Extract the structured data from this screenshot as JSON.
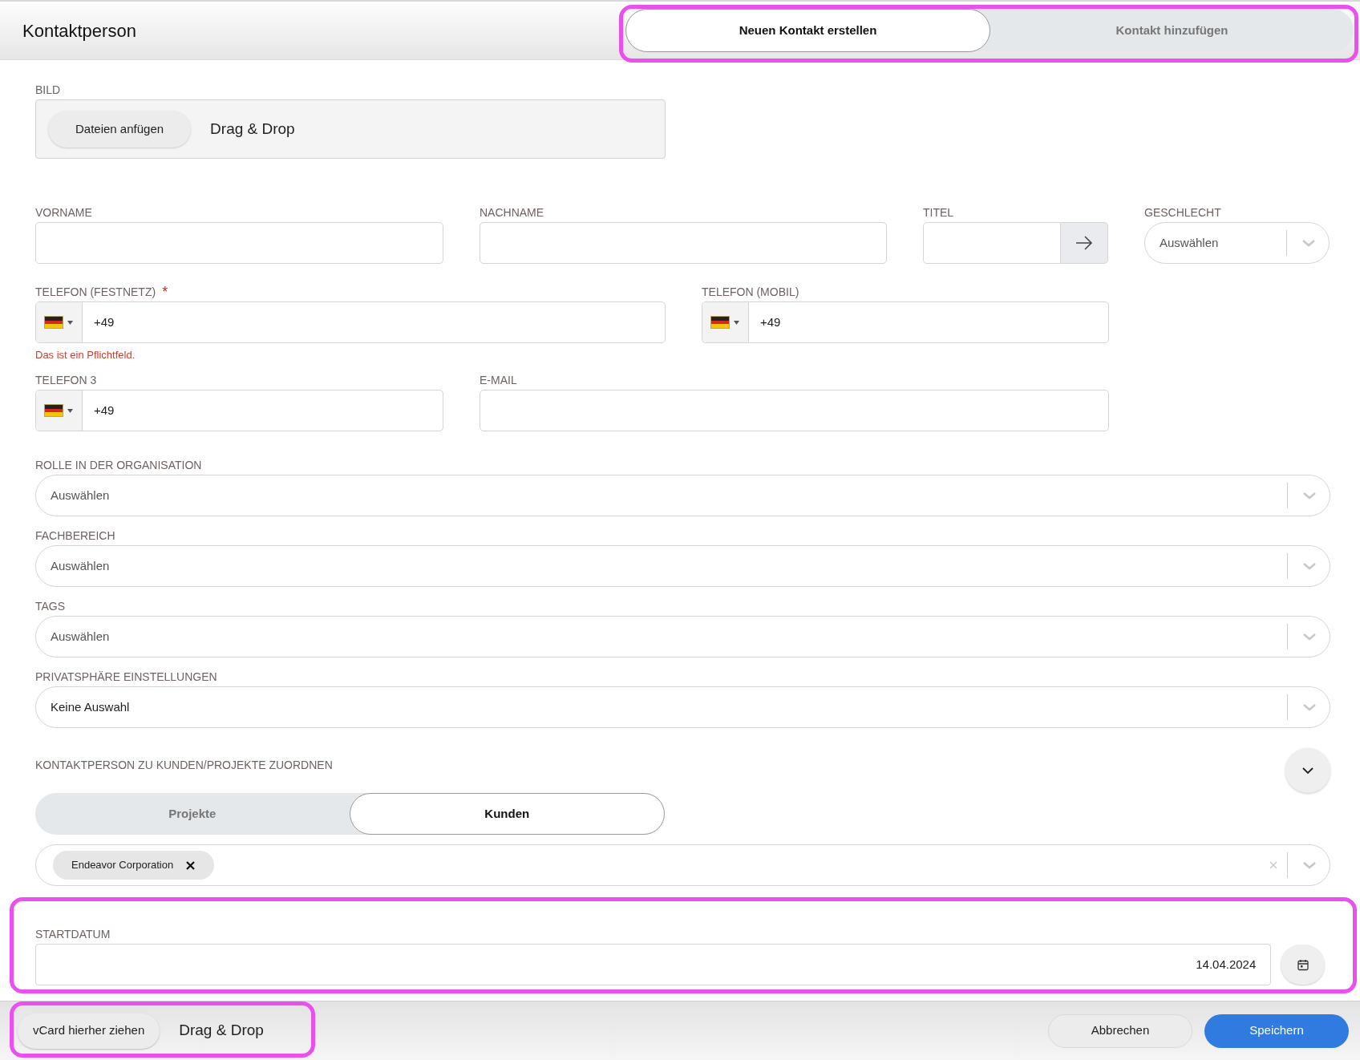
{
  "header": {
    "title": "Kontaktperson",
    "tabs": [
      {
        "label": "Neuen Kontakt erstellen",
        "selected": true
      },
      {
        "label": "Kontakt hinzufügen",
        "selected": false
      }
    ]
  },
  "image_upload": {
    "label": "BILD",
    "button": "Dateien anfügen",
    "hint": "Drag & Drop"
  },
  "name_row": [
    {
      "kind": "text",
      "label": "VORNAME"
    },
    {
      "kind": "text",
      "label": "NACHNAME"
    },
    {
      "kind": "text_action",
      "label": "TITEL"
    },
    {
      "kind": "select",
      "label": "GESCHLECHT",
      "placeholder": "Auswählen"
    }
  ],
  "phone_row": [
    {
      "kind": "phone",
      "label": "TELEFON (FESTNETZ)",
      "required_mark": "*",
      "value": "+49",
      "error": "Das ist ein Pflichtfeld."
    },
    {
      "kind": "phone",
      "label": "TELEFON (MOBIL)",
      "value": "+49"
    }
  ],
  "contact_row": [
    {
      "kind": "phone",
      "label": "TELEFON 3",
      "value": "+49"
    },
    {
      "kind": "text",
      "label": "E-MAIL"
    }
  ],
  "selects": [
    {
      "label": "ROLLE IN DER ORGANISATION",
      "placeholder": "Auswählen"
    },
    {
      "label": "FACHBEREICH",
      "placeholder": "Auswählen"
    },
    {
      "label": "TAGS",
      "placeholder": "Auswählen"
    },
    {
      "label": "PRIVATSPHÄRE EINSTELLUNGEN",
      "value": "Keine Auswahl"
    }
  ],
  "assignment": {
    "label": "KONTAKTPERSON ZU KUNDEN/PROJEKTE ZUORDNEN",
    "tabs": [
      {
        "label": "Projekte",
        "selected": false
      },
      {
        "label": "Kunden",
        "selected": true
      }
    ],
    "chips": [
      {
        "label": "Endeavor Corporation"
      }
    ]
  },
  "start_date": {
    "label": "STARTDATUM",
    "value": "14.04.2024"
  },
  "footer": {
    "vcard_button": "vCard hierher ziehen",
    "hint": "Drag & Drop",
    "buttons": [
      {
        "label": "Abbrechen",
        "kind": "secondary"
      },
      {
        "label": "Speichern",
        "kind": "primary"
      }
    ]
  }
}
